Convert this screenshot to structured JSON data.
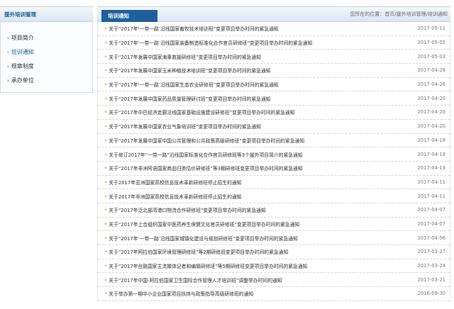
{
  "sidebar": {
    "title": "援外培训管理",
    "items": [
      {
        "label": "项目简介"
      },
      {
        "label": "培训通知"
      },
      {
        "label": "规章制度"
      },
      {
        "label": "承办单位"
      }
    ]
  },
  "main": {
    "tab_label": "培训通知",
    "breadcrumb": {
      "prefix": "您所在的位置：",
      "home": "首页",
      "sep1": "/",
      "section": "援外培训管理",
      "sep2": "/",
      "current": "培训通知"
    },
    "notices": [
      {
        "title": "关于“2017年‘一带一路’沿线国家畜牧技术培训班”变更项目举办时间的紧急通知",
        "date": "2017-05-11"
      },
      {
        "title": "关于“2017年‘一带一路’沿线国家装备制造标准化合作官员研修班”变更项目举办时间的紧急通知",
        "date": "2017-05-05"
      },
      {
        "title": "关于“2017年发展中国家海事救援研修班”变更项目举办时间的紧急通知",
        "date": "2017-05-03"
      },
      {
        "title": "关于“2017年发展中国家玉米种植技术培训班”变更项目举办时间的紧急通知",
        "date": "2017-04-28"
      },
      {
        "title": "关于“2017年‘一带一路’沿线国家生态农业研修班”变更项目举办时间的紧急通知",
        "date": "2017-04-26"
      },
      {
        "title": "关于“2017年发展中国家药品质量管理研讨班”变更项目举办时间的紧急通知",
        "date": "2017-04-20"
      },
      {
        "title": "关于“2017年中巴经济走廊沿线国家基础设施建设研修班”变更项目举办时间的紧急通知",
        "date": "2017-04-20"
      },
      {
        "title": "关于“2017年发展中国家农业气象培训班”变更项目举办时间的紧急通知",
        "date": "2017-04-20"
      },
      {
        "title": "关于“2017年发展中国家中国公共管理和公共政策高级研修班”变更项目举办时间的紧急通知",
        "date": "2017-04-18"
      },
      {
        "title": "关于修订2017年“一带一路”沿线国家标准化合作官员研修班等3个援外项目简介的紧急通知",
        "date": "2017-04-18"
      },
      {
        "title": "关于“2017年非洲阿语国家商品归类估价研修班”等3期研修班变更项目举办时间的紧急通知",
        "date": "2017-04-13"
      },
      {
        "title": "关于2017年亚洲国家高校信息技术革新研修班停止招生的通知",
        "date": "2017-04-11"
      },
      {
        "title": "关于2017年非洲国家高校信息技术革新研修班停止招生的通知",
        "date": "2017-04-11"
      },
      {
        "title": "关于“2017年泛北部湾港口物流合作研修班”变更项目举办时间的紧急通知",
        "date": "2017-04-07"
      },
      {
        "title": "关于“2017年上合组织国家中医药养生保健文化官员研修班”变更项目举办时间的紧急通知",
        "date": "2017-04-07"
      },
      {
        "title": "关于“2017年‘一带一路’沿线国家城镇化建设与规划研修班”变更项目举办时间的紧急通知",
        "date": "2017-04-06"
      },
      {
        "title": "关于“2017年阿拉伯国家环境管理研修班”等2期研修班变更项目举办时间的紧急通知",
        "date": "2017-03-27"
      },
      {
        "title": "关于“2017年丝路国家主流媒体记者和编辑研修班”等5期研修班变更项目举办时间的紧急通知",
        "date": "2017-03-24"
      },
      {
        "title": "关于“2017年中国-阿拉伯国家卫生国际合作管理人才培训班”调整举办时间的通知",
        "date": "2017-03-21"
      },
      {
        "title": "关于举办第一期中小企业国家项目扶持与政策指导高级研修班的通知",
        "date": "2016-09-30"
      }
    ]
  },
  "colors": {
    "accent": "#1e5f9c",
    "header_text": "#1a5c96",
    "arrow": "#c99b1a"
  },
  "icons": {
    "sidebar_bullet": "chevron-right-icon",
    "row_arrow": "double-chevron-right-icon"
  }
}
